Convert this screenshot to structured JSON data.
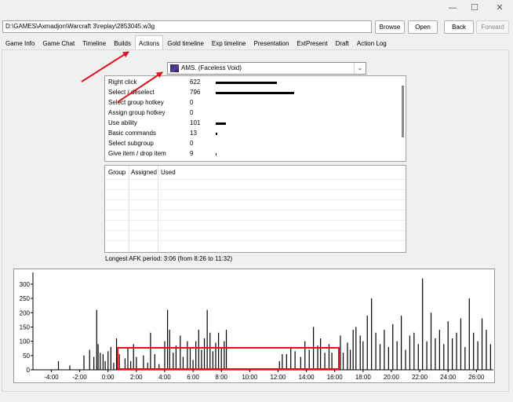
{
  "window": {
    "path": "D:\\GAMES\\Axmadjon\\Warcraft 3\\replay\\2853045.w3g",
    "minimize_glyph": "—",
    "maximize_glyph": "☐",
    "close_glyph": "✕"
  },
  "toolbar": {
    "browse_label": "Browse",
    "open_label": "Open",
    "back_label": "Back",
    "forward_label": "Forward"
  },
  "tabs": [
    {
      "label": "Game Info"
    },
    {
      "label": "Game Chat"
    },
    {
      "label": "Timeline"
    },
    {
      "label": "Builds"
    },
    {
      "label": "Actions",
      "active": true
    },
    {
      "label": "Gold timeline"
    },
    {
      "label": "Exp timeline"
    },
    {
      "label": "Presentation"
    },
    {
      "label": "ExtPresent"
    },
    {
      "label": "Draft"
    },
    {
      "label": "Action Log"
    }
  ],
  "player_select": {
    "value": "AMS. (Faceless Void)",
    "dropdown_glyph": "⌄"
  },
  "actions": [
    {
      "name": "Right click",
      "count": "622",
      "value": 622
    },
    {
      "name": "Select / deselect",
      "count": "796",
      "value": 796
    },
    {
      "name": "Select group hotkey",
      "count": "0",
      "value": 0
    },
    {
      "name": "Assign group hotkey",
      "count": "0",
      "value": 0
    },
    {
      "name": "Use ability",
      "count": "101",
      "value": 101
    },
    {
      "name": "Basic commands",
      "count": "13",
      "value": 13
    },
    {
      "name": "Select subgroup",
      "count": "0",
      "value": 0
    },
    {
      "name": "Give item / drop item",
      "count": "9",
      "value": 9
    }
  ],
  "group_table": {
    "headers": [
      "Group",
      "Assigned",
      "Used"
    ]
  },
  "afk_text": "Longest AFK period: 3:06 (from 8:26 to 11:32)",
  "colors": {
    "annotation_red": "#d8141c",
    "bar_black": "#000000"
  },
  "chart_data": {
    "type": "bar",
    "title": "",
    "xlabel": "",
    "ylabel": "",
    "ylim": [
      0,
      330
    ],
    "xlim_minutes": [
      -5.3,
      27.2
    ],
    "y_ticks": [
      0,
      50,
      100,
      150,
      200,
      250,
      300
    ],
    "x_tick_minutes": [
      -4,
      -2,
      0,
      2,
      4,
      6,
      8,
      10,
      12,
      14,
      16,
      18,
      20,
      22,
      24,
      26
    ],
    "x_tick_labels": [
      "-4:00",
      "-2:00",
      "0:00",
      "2:00",
      "4:00",
      "6:00",
      "8:00",
      "10:00",
      "12:00",
      "14:00",
      "16:00",
      "18:00",
      "20:00",
      "22:00",
      "24:00",
      "26:00"
    ],
    "grid": false,
    "bars": [
      [
        -3.5,
        30
      ],
      [
        -2.7,
        15
      ],
      [
        -1.7,
        50
      ],
      [
        -1.3,
        70
      ],
      [
        -1.0,
        45
      ],
      [
        -0.8,
        210
      ],
      [
        -0.7,
        90
      ],
      [
        -0.55,
        60
      ],
      [
        -0.35,
        55
      ],
      [
        -0.2,
        30
      ],
      [
        0.0,
        65
      ],
      [
        0.2,
        80
      ],
      [
        0.4,
        25
      ],
      [
        0.6,
        110
      ],
      [
        0.8,
        55
      ],
      [
        1.2,
        40
      ],
      [
        1.4,
        75
      ],
      [
        1.6,
        30
      ],
      [
        1.8,
        90
      ],
      [
        2.0,
        45
      ],
      [
        2.5,
        50
      ],
      [
        2.8,
        25
      ],
      [
        3.0,
        130
      ],
      [
        3.3,
        55
      ],
      [
        3.6,
        20
      ],
      [
        4.0,
        100
      ],
      [
        4.2,
        210
      ],
      [
        4.35,
        140
      ],
      [
        4.6,
        60
      ],
      [
        4.8,
        85
      ],
      [
        5.1,
        120
      ],
      [
        5.3,
        45
      ],
      [
        5.6,
        100
      ],
      [
        5.8,
        80
      ],
      [
        6.0,
        35
      ],
      [
        6.2,
        100
      ],
      [
        6.4,
        140
      ],
      [
        6.6,
        70
      ],
      [
        6.8,
        110
      ],
      [
        7.0,
        210
      ],
      [
        7.2,
        130
      ],
      [
        7.4,
        65
      ],
      [
        7.6,
        95
      ],
      [
        7.8,
        130
      ],
      [
        8.0,
        80
      ],
      [
        8.2,
        100
      ],
      [
        8.35,
        140
      ],
      [
        12.1,
        30
      ],
      [
        12.3,
        55
      ],
      [
        12.6,
        55
      ],
      [
        12.9,
        80
      ],
      [
        13.2,
        65
      ],
      [
        13.6,
        45
      ],
      [
        13.9,
        100
      ],
      [
        14.2,
        70
      ],
      [
        14.5,
        150
      ],
      [
        14.8,
        85
      ],
      [
        15.0,
        110
      ],
      [
        15.3,
        60
      ],
      [
        15.6,
        90
      ],
      [
        15.8,
        60
      ],
      [
        16.4,
        120
      ],
      [
        16.6,
        60
      ],
      [
        16.9,
        95
      ],
      [
        17.1,
        70
      ],
      [
        17.3,
        140
      ],
      [
        17.5,
        150
      ],
      [
        17.8,
        120
      ],
      [
        18.0,
        100
      ],
      [
        18.3,
        190
      ],
      [
        18.6,
        250
      ],
      [
        18.9,
        130
      ],
      [
        19.2,
        90
      ],
      [
        19.5,
        140
      ],
      [
        19.8,
        80
      ],
      [
        20.1,
        160
      ],
      [
        20.4,
        100
      ],
      [
        20.7,
        190
      ],
      [
        21.0,
        70
      ],
      [
        21.3,
        120
      ],
      [
        21.6,
        130
      ],
      [
        21.9,
        90
      ],
      [
        22.2,
        320
      ],
      [
        22.5,
        100
      ],
      [
        22.8,
        200
      ],
      [
        23.1,
        110
      ],
      [
        23.4,
        140
      ],
      [
        23.7,
        90
      ],
      [
        24.0,
        170
      ],
      [
        24.3,
        110
      ],
      [
        24.6,
        130
      ],
      [
        24.9,
        180
      ],
      [
        25.2,
        80
      ],
      [
        25.5,
        250
      ],
      [
        25.8,
        130
      ],
      [
        26.1,
        100
      ],
      [
        26.4,
        180
      ],
      [
        26.7,
        140
      ],
      [
        27.0,
        90
      ]
    ]
  }
}
